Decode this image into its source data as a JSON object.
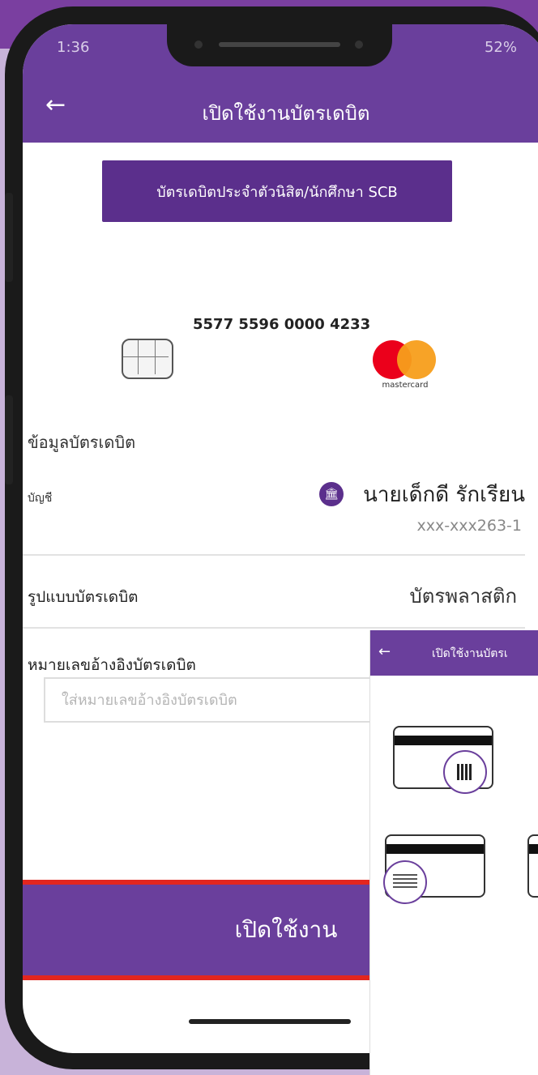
{
  "statusbar": {
    "time": "1:36",
    "battery": "52%"
  },
  "header": {
    "back_icon": "←",
    "title": "เปิดใช้งานบัตรเดบิต"
  },
  "banner": {
    "text": "บัตรเดบิตประจำตัวนิสิต/นักศึกษา SCB"
  },
  "card": {
    "number": "5577 5596 0000 4233",
    "brand": "mastercard",
    "brand_colors": {
      "red": "#eb001b",
      "orange": "#f79e1b"
    }
  },
  "details": {
    "section_title": "ข้อมูลบัตรเดบิต",
    "account_label": "บัญชี",
    "bank_icon_glyph": "🏛",
    "account_name": "นายเด็กดี รักเรียน",
    "account_number": "xxx-xxx263-1",
    "card_type_label": "รูปแบบบัตรเดบิต",
    "card_type_value": "บัตรพลาสติก",
    "ref_label": "หมายเลขอ้างอิงบัตรเดบิต",
    "ref_placeholder": "ใส่หมายเลขอ้างอิงบัตรเดบิต",
    "help_glyph": "?"
  },
  "activate_button": {
    "label": "เปิดใช้งาน"
  },
  "mini_screen": {
    "back_icon": "←",
    "title": "เปิดใช้งานบัตรเ"
  },
  "colors": {
    "primary": "#6a3f9c",
    "highlight": "#e3261f"
  }
}
